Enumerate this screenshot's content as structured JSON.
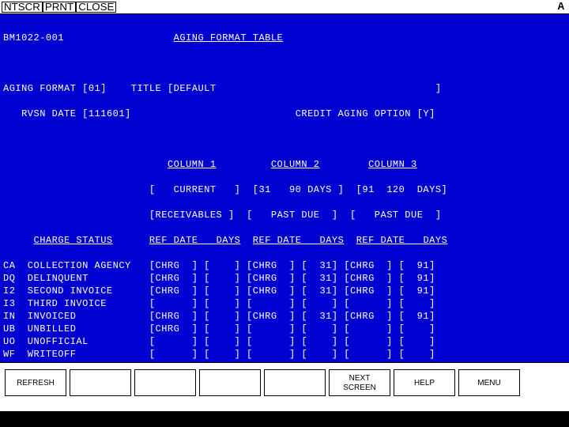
{
  "topbar": {
    "ntscr": "NTSCR",
    "prnt": "PRNT",
    "close": "CLOSE",
    "right": "A"
  },
  "header": {
    "screen_id": "BM1022-001",
    "title": "AGING FORMAT TABLE"
  },
  "form": {
    "aging_format_label": "AGING FORMAT",
    "aging_format_val": "01",
    "title_label": "TITLE",
    "title_val": "DEFAULT",
    "rvsn_date_label": "RVSN DATE",
    "rvsn_date_val": "111601",
    "credit_option_label": "CREDIT AGING OPTION",
    "credit_option_val": "Y"
  },
  "columns": {
    "col1_head": "COLUMN 1",
    "col1_range": "[   CURRENT   ]",
    "col1_title": "[RECEIVABLES ]",
    "col2_head": "COLUMN 2",
    "col2_range": "[31   90 DAYS ]",
    "col2_title": "[   PAST DUE  ]",
    "col3_head": "COLUMN 3",
    "col3_range": "[91  120  DAYS]",
    "col3_title": "[   PAST DUE  ]",
    "sub_head": "REF DATE   DAYS"
  },
  "charge_status_label": "CHARGE STATUS",
  "rows": [
    {
      "code": "CA",
      "desc": "COLLECTION AGENCY",
      "c1r": "[CHRG  ]",
      "c1d": "[    ]",
      "c2r": "[CHRG  ]",
      "c2d": "[  31]",
      "c3r": "[CHRG  ]",
      "c3d": "[  91]"
    },
    {
      "code": "DQ",
      "desc": "DELINQUENT",
      "c1r": "[CHRG  ]",
      "c1d": "[    ]",
      "c2r": "[CHRG  ]",
      "c2d": "[  31]",
      "c3r": "[CHRG  ]",
      "c3d": "[  91]"
    },
    {
      "code": "I2",
      "desc": "SECOND INVOICE",
      "c1r": "[CHRG  ]",
      "c1d": "[    ]",
      "c2r": "[CHRG  ]",
      "c2d": "[  31]",
      "c3r": "[CHRG  ]",
      "c3d": "[  91]"
    },
    {
      "code": "I3",
      "desc": "THIRD INVOICE",
      "c1r": "[      ]",
      "c1d": "[    ]",
      "c2r": "[      ]",
      "c2d": "[    ]",
      "c3r": "[      ]",
      "c3d": "[    ]"
    },
    {
      "code": "IN",
      "desc": "INVOICED",
      "c1r": "[CHRG  ]",
      "c1d": "[    ]",
      "c2r": "[CHRG  ]",
      "c2d": "[  31]",
      "c3r": "[CHRG  ]",
      "c3d": "[  91]"
    },
    {
      "code": "UB",
      "desc": "UNBILLED",
      "c1r": "[CHRG  ]",
      "c1d": "[    ]",
      "c2r": "[      ]",
      "c2d": "[    ]",
      "c3r": "[      ]",
      "c3d": "[    ]"
    },
    {
      "code": "UO",
      "desc": "UNOFFICIAL",
      "c1r": "[      ]",
      "c1d": "[    ]",
      "c2r": "[      ]",
      "c2d": "[    ]",
      "c3r": "[      ]",
      "c3d": "[    ]"
    },
    {
      "code": "WF",
      "desc": "WRITEOFF",
      "c1r": "[      ]",
      "c1d": "[    ]",
      "c2r": "[      ]",
      "c2d": "[    ]",
      "c3r": "[      ]",
      "c3d": "[    ]"
    },
    {
      "code": "  ",
      "desc": "",
      "c1r": "[      ]",
      "c1d": "[    ]",
      "c2r": "[      ]",
      "c2d": "[    ]",
      "c3r": "[      ]",
      "c3d": "[    ]"
    },
    {
      "code": "  ",
      "desc": "",
      "c1r": "[      ]",
      "c1d": "[    ]",
      "c2r": "[      ]",
      "c2d": "[    ]",
      "c3r": "[      ]",
      "c3d": "[    ]"
    },
    {
      "code": "  ",
      "desc": "",
      "c1r": "[      ]",
      "c1d": "[    ]",
      "c2r": "[      ]",
      "c2d": "[    ]",
      "c3r": "[      ]",
      "c3d": "[    ]"
    },
    {
      "code": "  ",
      "desc": "",
      "c1r": "[      ]",
      "c1d": "[    ]",
      "c2r": "[      ]",
      "c2d": "[    ]",
      "c3r": "[      ]",
      "c3d": "[    ]"
    }
  ],
  "fkeys": {
    "f1": "REFRESH",
    "f2": "",
    "f3": "",
    "f4": "",
    "f5": "",
    "f6": "NEXT\nSCREEN",
    "f7": "HELP",
    "f8": "MENU"
  }
}
